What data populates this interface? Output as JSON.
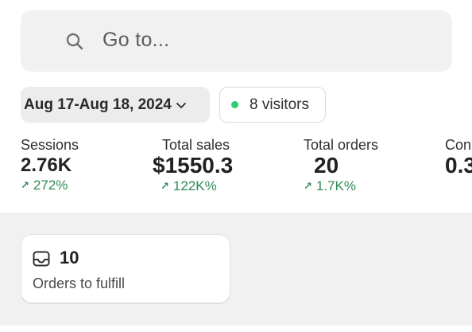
{
  "colors": {
    "positive": "#2e8b57",
    "online_dot": "#2ecc71",
    "band_bg": "#f1f1f1"
  },
  "search": {
    "placeholder": "Go to...",
    "icon": "search-icon"
  },
  "filters": {
    "date_range": "Aug 17-Aug 18, 2024",
    "date_icon": "chevron-down-icon",
    "visitors_label": "8 visitors"
  },
  "metrics": [
    {
      "label": "Sessions",
      "value": "2.76K",
      "change": "272%"
    },
    {
      "label": "Total sales",
      "value": "$1550.3",
      "change": "122K%"
    },
    {
      "label": "Total orders",
      "value": "20",
      "change": "1.7K%"
    },
    {
      "label": "Con",
      "value": "0.3",
      "change": ""
    }
  ],
  "fulfill_card": {
    "icon": "inbox-icon",
    "count": "10",
    "label": "Orders to fulfill"
  }
}
